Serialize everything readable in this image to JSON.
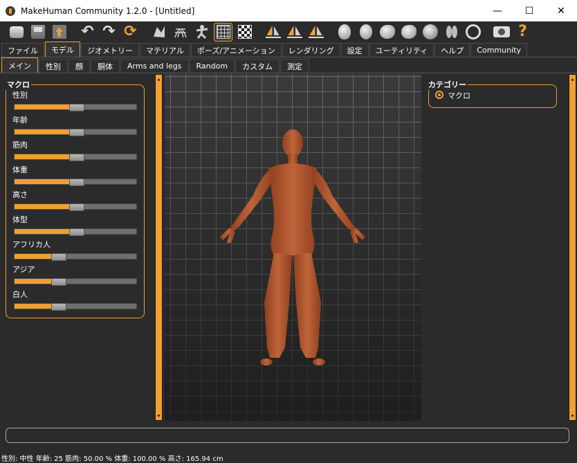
{
  "window": {
    "title": "MakeHuman Community 1.2.0 - [Untitled]",
    "minimize": "—",
    "maximize": "☐",
    "close": "✕"
  },
  "toolbar": {
    "undo": "↶",
    "redo": "↷",
    "reset": "⟳",
    "help": "?"
  },
  "main_tabs": [
    {
      "label": "ファイル",
      "active": false
    },
    {
      "label": "モデル",
      "active": true
    },
    {
      "label": "ジオメトリー",
      "active": false
    },
    {
      "label": "マテリアル",
      "active": false
    },
    {
      "label": "ポーズ/アニメーション",
      "active": false
    },
    {
      "label": "レンダリング",
      "active": false
    },
    {
      "label": "設定",
      "active": false
    },
    {
      "label": "ユーティリティ",
      "active": false
    },
    {
      "label": "ヘルプ",
      "active": false
    },
    {
      "label": "Community",
      "active": false
    }
  ],
  "sub_tabs": [
    {
      "label": "メイン",
      "active": true
    },
    {
      "label": "性別",
      "active": false
    },
    {
      "label": "顔",
      "active": false
    },
    {
      "label": "胴体",
      "active": false
    },
    {
      "label": "Arms and legs",
      "active": false
    },
    {
      "label": "Random",
      "active": false
    },
    {
      "label": "カスタム",
      "active": false
    },
    {
      "label": "測定",
      "active": false
    }
  ],
  "macro": {
    "title": "マクロ",
    "sliders": [
      {
        "label": "性別",
        "value": 0.5
      },
      {
        "label": "年齢",
        "value": 0.5
      },
      {
        "label": "筋肉",
        "value": 0.5
      },
      {
        "label": "体重",
        "value": 0.5
      },
      {
        "label": "高さ",
        "value": 0.5
      },
      {
        "label": "体型",
        "value": 0.5
      },
      {
        "label": "アフリカ人",
        "value": 0.333
      },
      {
        "label": "アジア",
        "value": 0.333
      },
      {
        "label": "白人",
        "value": 0.333
      }
    ]
  },
  "category": {
    "title": "カテゴリー",
    "option": "マクロ"
  },
  "status": {
    "text": "性別: 中性  年齢: 25  筋肉: 50.00 %  体重: 100.00 %  高さ: 165.94 cm"
  },
  "colors": {
    "accent": "#f0a030",
    "skin": "#b5592f",
    "background": "#2b2b2b"
  }
}
